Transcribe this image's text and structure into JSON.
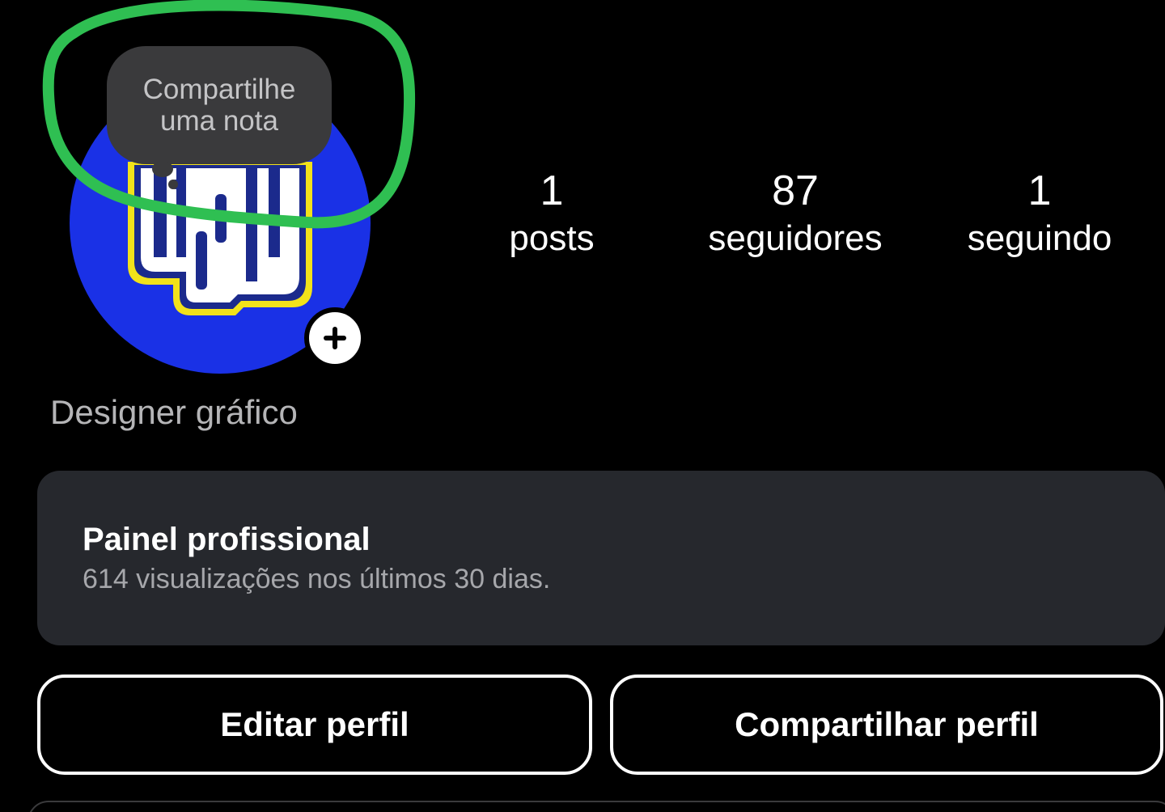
{
  "note": {
    "text": "Compartilhe uma nota"
  },
  "profile": {
    "avatar_icons": [
      "logo-avatar"
    ],
    "category": "Designer gráfico"
  },
  "stats": [
    {
      "value": "1",
      "label": "posts"
    },
    {
      "value": "87",
      "label": "seguidores"
    },
    {
      "value": "1",
      "label": "seguindo"
    }
  ],
  "dashboard": {
    "title": "Painel profissional",
    "subtitle": "614 visualizações nos últimos 30 dias."
  },
  "buttons": {
    "edit_profile": "Editar perfil",
    "share_profile": "Compartilhar perfil"
  },
  "colors": {
    "background": "#000000",
    "avatar_blue": "#1a31e6",
    "logo_yellow": "#f2e21a",
    "highlight_green": "#2fbf52",
    "card": "#26282d",
    "bubble": "#3a3a3c"
  }
}
